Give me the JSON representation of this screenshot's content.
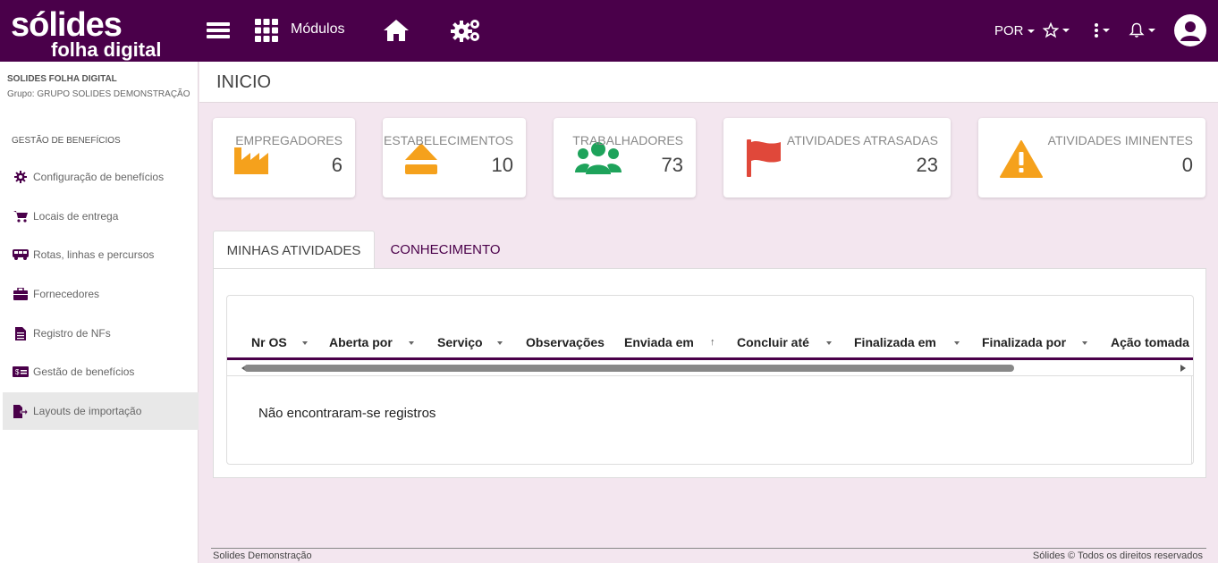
{
  "app": {
    "logo_line1": "sólides",
    "logo_line2": "folha digital"
  },
  "topbar": {
    "modules_label": "Módulos",
    "language": "POR",
    "icons": [
      "menu-icon",
      "grid-icon",
      "home-icon",
      "gears-icon",
      "star-icon",
      "kebab-icon",
      "bell-icon",
      "user-icon"
    ]
  },
  "sidebar": {
    "company": "SOLIDES FOLHA DIGITAL",
    "group": "Grupo: GRUPO SOLIDES DEMONSTRAÇÃO",
    "section_title": "GESTÃO DE BENEFÍCIOS",
    "items": [
      {
        "label": "Configuração de benefícios",
        "icon": "gear-icon"
      },
      {
        "label": "Locais de entrega",
        "icon": "cart-icon"
      },
      {
        "label": "Rotas, linhas e percursos",
        "icon": "bus-icon"
      },
      {
        "label": "Fornecedores",
        "icon": "briefcase-icon"
      },
      {
        "label": "Registro de NFs",
        "icon": "document-icon"
      },
      {
        "label": "Gestão de benefícios",
        "icon": "money-icon"
      },
      {
        "label": "Layouts de importação",
        "icon": "import-icon",
        "active": true
      }
    ]
  },
  "page": {
    "title": "INICIO"
  },
  "cards": [
    {
      "label": "EMPREGADORES",
      "value": "6",
      "icon": "factory-icon",
      "color": "#f5a11c"
    },
    {
      "label": "ESTABELECIMENTOS",
      "value": "10",
      "icon": "eject-icon",
      "color": "#f5a11c"
    },
    {
      "label": "TRABALHADORES",
      "value": "73",
      "icon": "users-icon",
      "color": "#1ea35b"
    },
    {
      "label": "ATIVIDADES ATRASADAS",
      "value": "23",
      "icon": "flag-icon",
      "color": "#e0483a"
    },
    {
      "label": "ATIVIDADES IMINENTES",
      "value": "0",
      "icon": "warning-icon",
      "color": "#f5a11c"
    }
  ],
  "tabs": [
    {
      "label": "MINHAS ATIVIDADES",
      "active": true
    },
    {
      "label": "CONHECIMENTO",
      "active": false
    }
  ],
  "table": {
    "columns": [
      "Nr OS",
      "Aberta por",
      "Serviço",
      "Observações",
      "Enviada em",
      "Concluir até",
      "Finalizada em",
      "Finalizada por",
      "Ação tomada"
    ],
    "empty_message": "Não encontraram-se registros"
  },
  "footer": {
    "left": "Solides Demonstração",
    "right": "Sólides © Todos os direitos reservados"
  },
  "colors": {
    "brand": "#4a004a",
    "background": "#f3e6ef",
    "accent_orange": "#f5a11c",
    "accent_green": "#1ea35b",
    "accent_red": "#e0483a"
  }
}
